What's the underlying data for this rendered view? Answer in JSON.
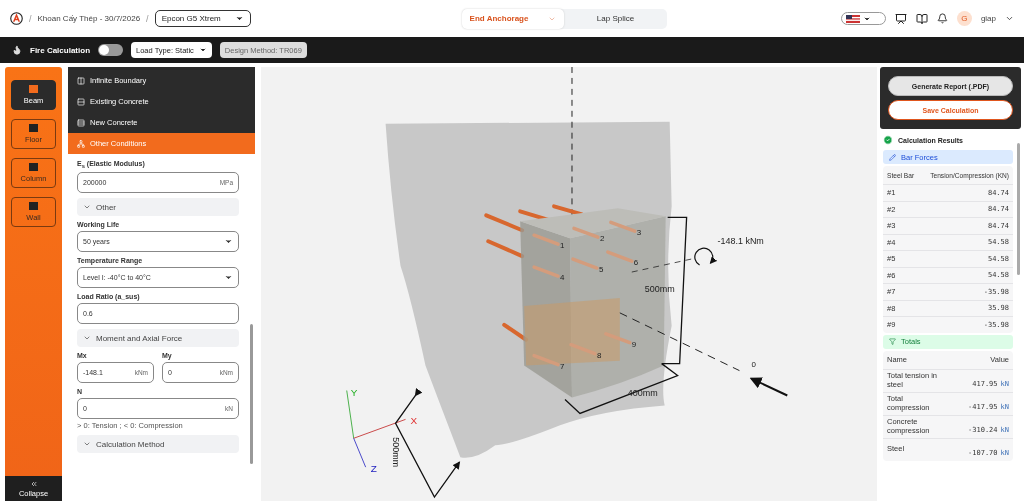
{
  "header": {
    "separators": [
      "/",
      "/"
    ],
    "project": "Khoan Cấy Thép - 30/7/2026",
    "product": "Epcon G5 Xtrem",
    "mode_tabs": [
      {
        "label": "End Anchorage",
        "selected": true
      },
      {
        "label": "Lap Splice",
        "selected": false
      }
    ],
    "user": {
      "initial": "G",
      "name": "giap"
    }
  },
  "toolbar": {
    "fire_calculation": {
      "label": "Fire Calculation",
      "on": false
    },
    "load_type": "Load Type: Static",
    "design_method": {
      "label": "Design Method: TR069",
      "disabled": true
    }
  },
  "rail": {
    "items": [
      {
        "label": "Beam",
        "selected": true
      },
      {
        "label": "Floor",
        "selected": false
      },
      {
        "label": "Column",
        "selected": false
      },
      {
        "label": "Wall",
        "selected": false
      }
    ],
    "collapse": "Collapse"
  },
  "menu": [
    {
      "label": "Infinite Boundary",
      "selected": false
    },
    {
      "label": "Existing Concrete",
      "selected": false
    },
    {
      "label": "New Concrete",
      "selected": false
    },
    {
      "label": "Other Conditions",
      "selected": true
    }
  ],
  "form": [
    {
      "kind": "input",
      "label": "E$_{s}$ (Elastic Modulus)",
      "value": "200000",
      "unit": "MPa"
    },
    {
      "kind": "section",
      "label": "Other",
      "expanded": true
    },
    {
      "kind": "select",
      "label": "Working Life",
      "value": "50 years"
    },
    {
      "kind": "select",
      "label": "Temperature Range",
      "value": "Level I: -40°C to 40°C"
    },
    {
      "kind": "input",
      "label": "Load Ratio (a_sus)",
      "value": "0.6"
    },
    {
      "kind": "section",
      "label": "Moment and Axial Force",
      "expanded": true
    },
    {
      "kind": "pair",
      "fields": [
        {
          "label": "Mx",
          "value": "-148.1",
          "unit": "kNm"
        },
        {
          "label": "My",
          "value": "0",
          "unit": "kNm"
        }
      ]
    },
    {
      "kind": "input",
      "label": "N",
      "value": "0",
      "unit": "kN"
    },
    {
      "kind": "hint",
      "text": "> 0: Tension ; < 0: Compression"
    },
    {
      "kind": "section",
      "label": "Calculation Method",
      "expanded": true
    }
  ],
  "viewer": {
    "moment_label": "-148.1 kNm",
    "height_label": "500mm",
    "width_label": "400mm",
    "depth_label": "500mm",
    "load_label": "0",
    "axes": [
      "X",
      "Y",
      "Z"
    ],
    "bar_labels": [
      "1",
      "2",
      "3",
      "4",
      "5",
      "6",
      "7",
      "8",
      "9"
    ]
  },
  "results": {
    "actions": [
      {
        "kind": "primary",
        "label": "Generate Report (.PDF)"
      },
      {
        "kind": "secondary",
        "label": "Save Calculation"
      }
    ],
    "title": "Calculation Results",
    "bar_forces": {
      "title": "Bar Forces",
      "columns": [
        "Steel Bar",
        "Tension/Compression (KN)"
      ],
      "rows": [
        [
          "#1",
          "84.74"
        ],
        [
          "#2",
          "84.74"
        ],
        [
          "#3",
          "84.74"
        ],
        [
          "#4",
          "54.58"
        ],
        [
          "#5",
          "54.58"
        ],
        [
          "#6",
          "54.58"
        ],
        [
          "#7",
          "-35.98"
        ],
        [
          "#8",
          "35.98"
        ],
        [
          "#9",
          "-35.98"
        ]
      ]
    },
    "totals": {
      "title": "Totals",
      "columns": [
        "Name",
        "Value"
      ],
      "rows": [
        {
          "name": "Total tension in steel",
          "value": "417.95",
          "unit": "kN"
        },
        {
          "name": "Total compression",
          "value": "-417.95",
          "unit": "kN"
        },
        {
          "name": "Concrete compression",
          "value": "-310.24",
          "unit": "kN"
        },
        {
          "name": "Steel",
          "value": "-107.70",
          "unit": "kN"
        }
      ]
    }
  }
}
